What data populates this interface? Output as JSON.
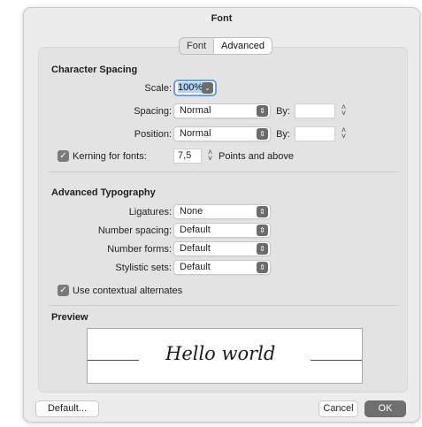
{
  "window": {
    "title": "Font"
  },
  "tabs": [
    {
      "label": "Font",
      "selected": false
    },
    {
      "label": "Advanced",
      "selected": true
    }
  ],
  "character_spacing": {
    "title": "Character Spacing",
    "scale_label": "Scale:",
    "scale_value": "100%",
    "spacing_label": "Spacing:",
    "spacing_value": "Normal",
    "spacing_by_label": "By:",
    "spacing_by_value": "",
    "position_label": "Position:",
    "position_value": "Normal",
    "position_by_label": "By:",
    "position_by_value": "",
    "kerning_label": "Kerning for fonts:",
    "kerning_checked": true,
    "kerning_value": "7,5",
    "kerning_suffix": "Points and above"
  },
  "advanced_typography": {
    "title": "Advanced Typography",
    "ligatures_label": "Ligatures:",
    "ligatures_value": "None",
    "number_spacing_label": "Number spacing:",
    "number_spacing_value": "Default",
    "number_forms_label": "Number forms:",
    "number_forms_value": "Default",
    "stylistic_sets_label": "Stylistic sets:",
    "stylistic_sets_value": "Default",
    "contextual_label": "Use contextual alternates",
    "contextual_checked": true
  },
  "preview": {
    "title": "Preview",
    "sample_text": "Hello world"
  },
  "buttons": {
    "default_label": "Default...",
    "cancel_label": "Cancel",
    "ok_label": "OK"
  },
  "icons": {
    "popup_arrows": "up-down-chevron-icon",
    "stepper": "stepper-icon",
    "checkmark": "checkmark-icon"
  },
  "colors": {
    "accent_focus": "#6f9fdc",
    "selection": "#b3d0f6",
    "primary_button": "#6f6f6f"
  }
}
